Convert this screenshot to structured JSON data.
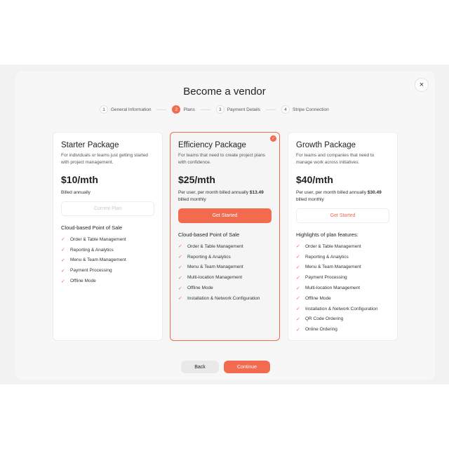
{
  "dialog": {
    "title": "Become a vendor",
    "close_icon": "×"
  },
  "steps": [
    {
      "number": "1",
      "label": "General Information",
      "active": false
    },
    {
      "number": "2",
      "label": "Plans",
      "active": true
    },
    {
      "number": "3",
      "label": "Payment Details",
      "active": false
    },
    {
      "number": "4",
      "label": "Stripe Connection",
      "active": false
    }
  ],
  "plans": [
    {
      "name": "Starter Package",
      "description": "For individuals or teams just getting started with project management.",
      "price": "$10/mth",
      "billing_text": "Billed annually",
      "billing_bold": "",
      "billing_suffix": "",
      "button_label": "Current Plan",
      "features_title": "Cloud-based Point of Sale",
      "features": [
        "Order & Table Management",
        "Reporting & Analytics",
        "Menu & Team Management",
        "Payment Processing",
        "Offline Mode"
      ]
    },
    {
      "name": "Efficiency Package",
      "description": "For teams that need to create project plans with confidence.",
      "price": "$25/mth",
      "billing_text": "Per user, per month billed annually ",
      "billing_bold": "$13.49",
      "billing_suffix": " billed monthly",
      "button_label": "Get Started",
      "features_title": "Cloud-based Point of Sale",
      "features": [
        "Order & Table Management",
        "Reporting & Analytics",
        "Menu & Team Management",
        "Multi-location Management",
        "Offline Mode",
        "Installation & Network Configuration"
      ]
    },
    {
      "name": "Growth Package",
      "description": "For teams and companies that need to manage work across initiatives.",
      "price": "$40/mth",
      "billing_text": "Per user, per month billed annually ",
      "billing_bold": "$30.49",
      "billing_suffix": " billed monthly",
      "button_label": "Get Started",
      "features_title": "Highlights of plan features:",
      "features": [
        "Order & Table Management",
        "Reporting & Analytics",
        "Menu & Team Management",
        "Payment Processing",
        "Multi-location Management",
        "Offline Mode",
        "Installation & Network Configuration",
        "QR Code Ordering",
        "Online Ordering"
      ]
    }
  ],
  "footer": {
    "back_label": "Back",
    "continue_label": "Continue"
  },
  "colors": {
    "accent": "#f26b4f"
  }
}
